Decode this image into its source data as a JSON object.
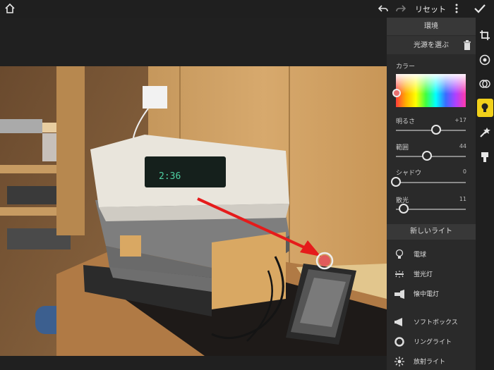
{
  "topbar": {
    "reset_label": "リセット"
  },
  "panel": {
    "header": "環境",
    "select_light": "光源を選ぶ",
    "color_label": "カラー",
    "sliders": [
      {
        "label": "明るさ",
        "value": "+17",
        "fraction": 0.58
      },
      {
        "label": "範囲",
        "value": "44",
        "fraction": 0.44
      },
      {
        "label": "シャドウ",
        "value": "0",
        "fraction": 0.0
      },
      {
        "label": "散光",
        "value": "11",
        "fraction": 0.11
      }
    ],
    "new_light_header": "新しいライト",
    "lights": [
      {
        "label": "電球",
        "icon": "bulb-icon"
      },
      {
        "label": "蛍光灯",
        "icon": "fluorescent-icon"
      },
      {
        "label": "懐中電灯",
        "icon": "flashlight-icon"
      },
      {
        "label": "ソフトボックス",
        "icon": "softbox-icon"
      },
      {
        "label": "リングライト",
        "icon": "ring-light-icon"
      },
      {
        "label": "放射ライト",
        "icon": "radial-light-icon"
      }
    ]
  },
  "photo": {
    "clock_text": "2:36"
  },
  "colors": {
    "accent": "#f1d01a",
    "panel_bg": "#2a2a2a"
  }
}
